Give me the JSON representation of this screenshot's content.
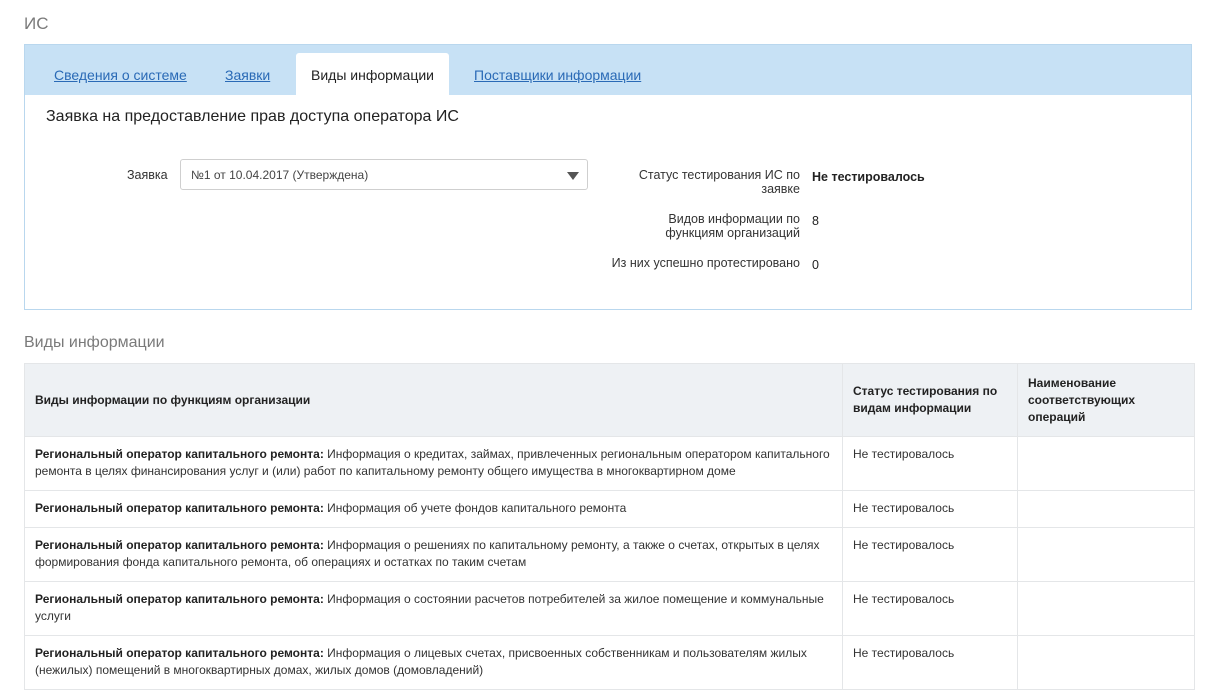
{
  "page": {
    "title": "ИС"
  },
  "tabs": [
    {
      "label": "Сведения о системе",
      "active": false
    },
    {
      "label": "Заявки",
      "active": false
    },
    {
      "label": "Виды информации",
      "active": true
    },
    {
      "label": "Поставщики информации",
      "active": false
    }
  ],
  "request": {
    "heading": "Заявка на предоставление прав доступа оператора ИС",
    "field_label": "Заявка",
    "selected_value": "№1 от 10.04.2017 (Утверждена)"
  },
  "stats": {
    "test_status_label": "Статус тестирования ИС по заявке",
    "test_status_value": "Не тестировалось",
    "types_count_label": "Видов информации по функциям организаций",
    "types_count_value": "8",
    "tested_label": "Из них успешно протестировано",
    "tested_value": "0"
  },
  "table": {
    "heading": "Виды информации",
    "columns": [
      "Виды информации по функциям организации",
      "Статус тестирования по видам информации",
      "Наименование соответствующих операций"
    ],
    "rows": [
      {
        "function": "Региональный оператор капитального ремонта:",
        "text": "Информация о кредитах, займах, привлеченных региональным оператором капитального ремонта в целях финансирования услуг и (или) работ по капитальному ремонту общего имущества в многоквартирном доме",
        "status": "Не тестировалось",
        "operations": ""
      },
      {
        "function": "Региональный оператор капитального ремонта:",
        "text": "Информация об учете фондов капитального ремонта",
        "status": "Не тестировалось",
        "operations": ""
      },
      {
        "function": "Региональный оператор капитального ремонта:",
        "text": "Информация о решениях по капитальному ремонту, а также о счетах, открытых в целях формирования фонда капитального ремонта, об операциях и остатках по таким счетам",
        "status": "Не тестировалось",
        "operations": ""
      },
      {
        "function": "Региональный оператор капитального ремонта:",
        "text": "Информация о состоянии расчетов потребителей за жилое помещение и коммунальные услуги",
        "status": "Не тестировалось",
        "operations": ""
      },
      {
        "function": "Региональный оператор капитального ремонта:",
        "text": "Информация о лицевых счетах, присвоенных собственникам и пользователям жилых (нежилых) помещений в многоквартирных домах, жилых домов (домовладений)",
        "status": "Не тестировалось",
        "operations": ""
      }
    ]
  },
  "colors": {
    "tabbar_bg": "#c7e1f5",
    "link": "#2a6ab6",
    "panel_border": "#b9d7ee",
    "table_header_bg": "#eef1f4"
  }
}
